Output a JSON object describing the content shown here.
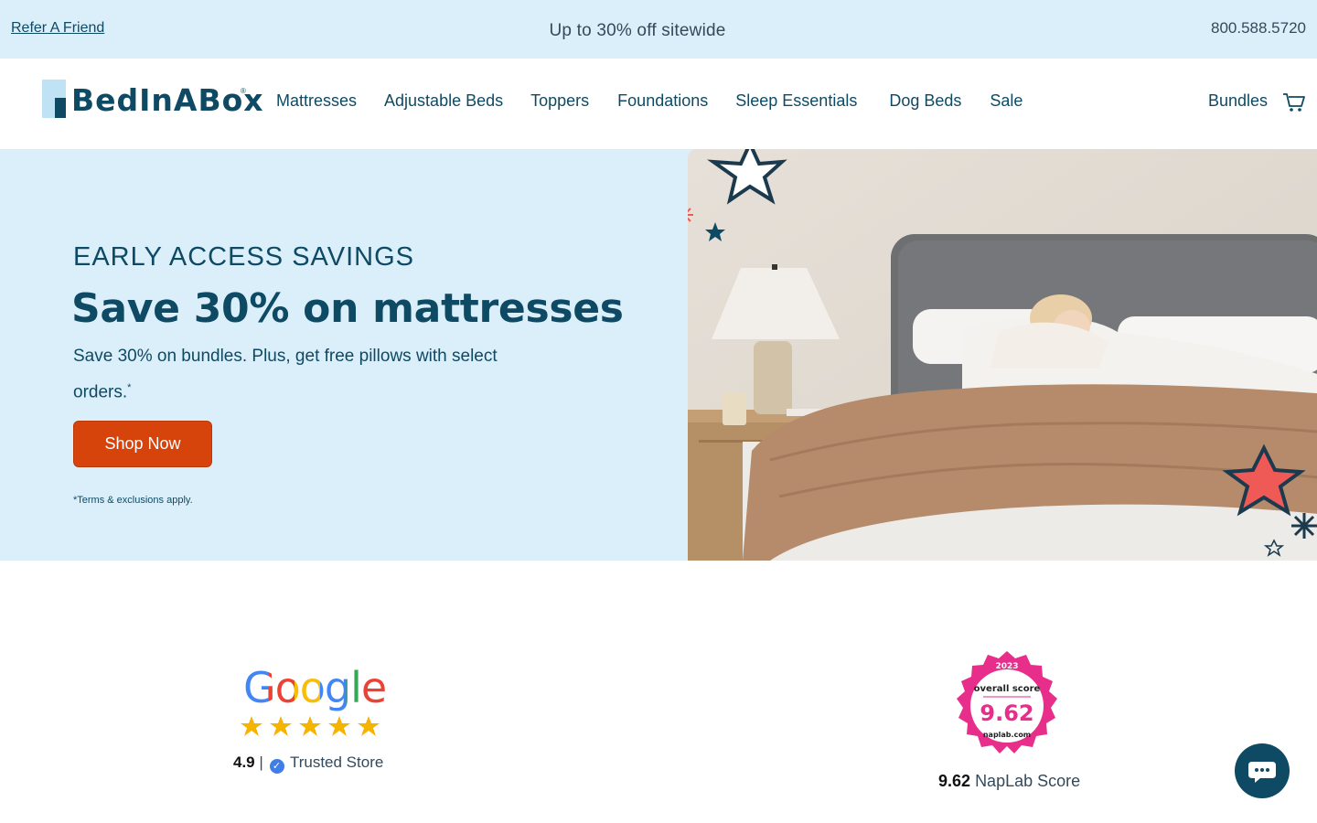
{
  "topbar": {
    "refer_link": "Refer A Friend",
    "promo": "Up to 30% off sitewide",
    "phone": "800.588.5720"
  },
  "header": {
    "logo_text": "BedInABox",
    "logo_reg": "®",
    "nav": [
      {
        "label": "Mattresses"
      },
      {
        "label": "Adjustable Beds"
      },
      {
        "label": "Toppers"
      },
      {
        "label": "Foundations"
      },
      {
        "label": "Sleep Essentials"
      },
      {
        "label": "Dog Beds"
      },
      {
        "label": "Sale"
      }
    ],
    "bundles": "Bundles",
    "cart_icon": "cart-icon"
  },
  "hero": {
    "eyebrow": "EARLY ACCESS SAVINGS",
    "headline": "Save 30% on mattresses",
    "subtext": "Save 30% on bundles. Plus, get free pillows with select orders.",
    "subtext_mark": "*",
    "cta": "Shop Now",
    "terms": "*Terms & exclusions apply."
  },
  "reviews": {
    "google_logo": "Google",
    "google_stars": 5,
    "google_rating": "4.9",
    "google_divider": "|",
    "google_label": "Trusted Store",
    "naplab_badge_year": "2023",
    "naplab_badge_label": "overall score",
    "naplab_badge_value": "9.62",
    "naplab_badge_site": "naplab.com",
    "naplab_score": "9.62",
    "naplab_label": "NapLab Score"
  },
  "colors": {
    "brand_navy": "#0e4a64",
    "light_blue": "#dbeffa",
    "cta_orange": "#d6440c",
    "star_gold": "#f4b400",
    "naplab_pink": "#e62e8a"
  },
  "chat": {
    "icon": "chat-bubble-icon"
  }
}
